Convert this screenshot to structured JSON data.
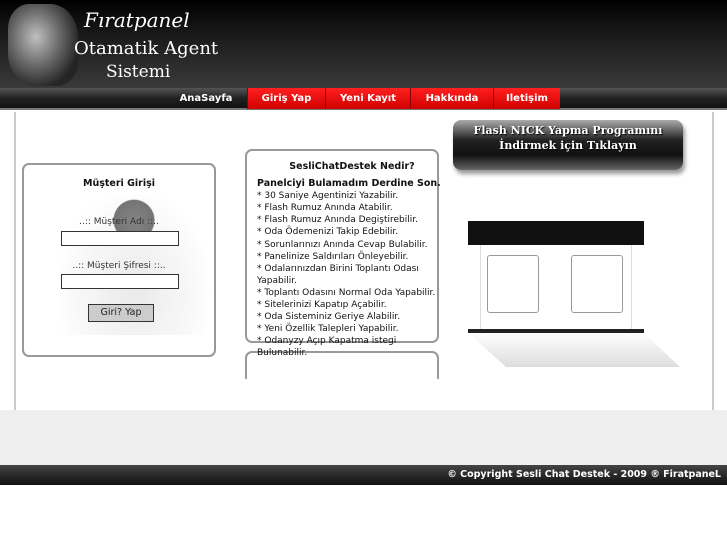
{
  "header": {
    "logo_line1": "Fıratpanel",
    "logo_line2": "Otamatik Agent",
    "logo_line3": "Sistemi"
  },
  "nav": [
    {
      "label": "AnaSayfa"
    },
    {
      "label": "Giriş Yap"
    },
    {
      "label": "Yeni Kayıt"
    },
    {
      "label": "Hakkında"
    },
    {
      "label": "Iletişim"
    }
  ],
  "login": {
    "title": "Müşteri Girişi",
    "username_label": "..:: Müşteri Adı ::..",
    "password_label": "..:: Müşteri Şifresi ::..",
    "username_value": "",
    "password_value": "",
    "submit": "Giri? Yap"
  },
  "about": {
    "title": "SesliChatDestek Nedir?",
    "subtitle": "Panelciyi Bulamadım Derdine Son.",
    "items": [
      "* 30 Saniye Agentinizi Yazabilir.",
      "* Flash Rumuz Anında Atabilir.",
      "* Flash Rumuz Anında Degiştirebilir.",
      "* Oda Ödemenizi Takip Edebilir.",
      "* Sorunlarınızı Anında Cevap Bulabilir.",
      "* Panelinize Saldırıları Önleyebilir.",
      "* Odalarınızdan Birini Toplantı Odası Yapabilir.",
      "* Toplantı Odasını Normal Oda Yapabilir.",
      "* Sitelerinizi Kapatıp Açabilir.",
      "* Oda Sisteminiz Geriye Alabilir.",
      "* Yeni Özellik Talepleri Yapabilir.",
      "* Odanyzy Açıp Kapatma istegi Bulunabilir."
    ]
  },
  "flash_banner": "Flash NICK Yapma Programını İndirmek için Tıklayın",
  "footer": "© Copyright Sesli Chat Destek - 2009 ® FiratpaneL"
}
